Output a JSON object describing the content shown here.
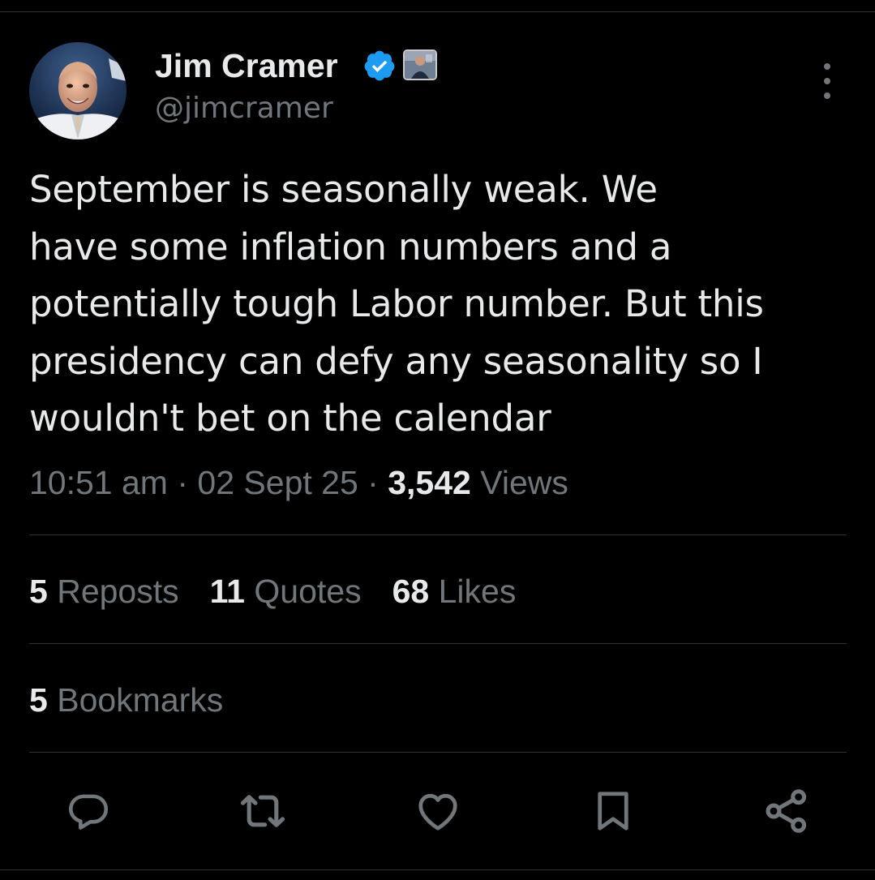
{
  "author": {
    "display_name": "Jim Cramer",
    "handle": "@jimcramer"
  },
  "icons": {
    "verified": "verified-badge-icon",
    "affiliate": "affiliate-badge-icon",
    "more": "more-options-icon"
  },
  "tweet": {
    "text": "September is seasonally weak. We\nhave some inflation numbers and a\npotentially tough Labor number. But this\npresidency can defy any seasonality so I\nwouldn't bet on the calendar",
    "time": "10:51 am",
    "date": "02 Sept 25",
    "separator": "·",
    "views_count": "3,542",
    "views_label": "Views"
  },
  "stats": {
    "reposts_count": "5",
    "reposts_label": "Reposts",
    "quotes_count": "11",
    "quotes_label": "Quotes",
    "likes_count": "68",
    "likes_label": "Likes",
    "bookmarks_count": "5",
    "bookmarks_label": "Bookmarks"
  },
  "actions": [
    "reply-icon",
    "repost-icon",
    "like-icon",
    "bookmark-icon",
    "share-icon"
  ],
  "colors": {
    "background": "#000000",
    "text_primary": "#e7e9ea",
    "text_secondary": "#71767b",
    "divider": "#2f3336",
    "verified_blue": "#1d9bf0"
  }
}
